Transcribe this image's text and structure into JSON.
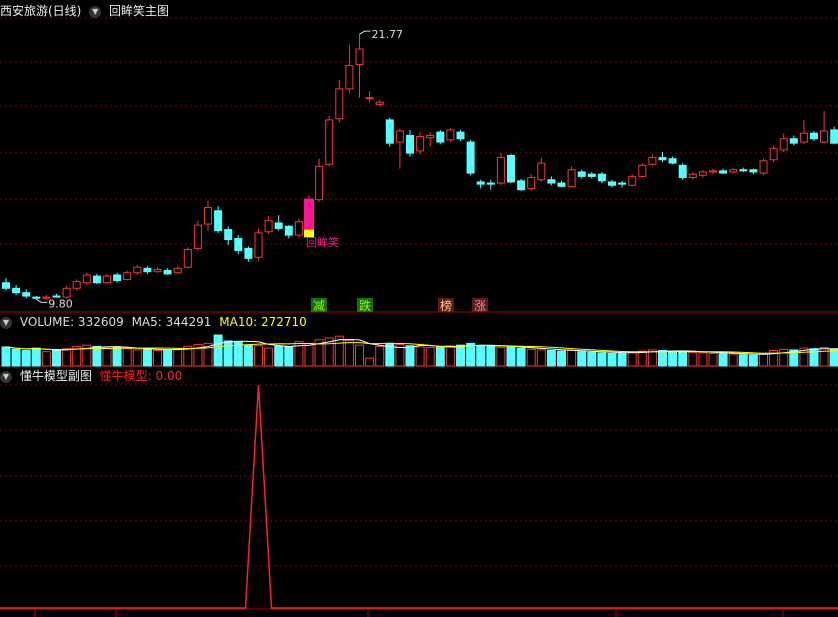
{
  "main_panel": {
    "stock_title": "西安旅游(日线)",
    "indicator_title": "回眸笑主图",
    "high_label": "21.77",
    "low_label": "9.80",
    "signal_label": "回眸笑",
    "markers": [
      "减",
      "跌",
      "榜",
      "涨"
    ]
  },
  "volume_panel": {
    "title": "VOLUME: 332609",
    "ma5_label": "MA5: 344291",
    "ma10_label": "MA10: 272710"
  },
  "sub_panel": {
    "title": "懂牛模型副图",
    "series_label": "懂牛模型: 0.00"
  },
  "colors": {
    "up": "#ff3232",
    "down": "#54ffff",
    "grid": "#8b0000",
    "ma5": "#ffffff",
    "ma10": "#ffff00",
    "signal": "#ff1493",
    "model_line": "#ff2020"
  },
  "chart_data": {
    "type": "candlestick",
    "price_range": [
      9.5,
      22.5
    ],
    "high": 21.77,
    "low": 9.8,
    "candles": [
      [
        10.55,
        10.3,
        10.75,
        10.2
      ],
      [
        10.3,
        10.1,
        10.45,
        10.0
      ],
      [
        10.1,
        9.95,
        10.25,
        9.85
      ],
      [
        9.9,
        9.85,
        9.95,
        9.8
      ],
      [
        9.85,
        9.9,
        10.0,
        9.8
      ],
      [
        9.95,
        9.92,
        10.05,
        9.88
      ],
      [
        9.9,
        10.3,
        10.4,
        9.85
      ],
      [
        10.3,
        10.6,
        10.7,
        10.2
      ],
      [
        10.55,
        10.9,
        11.0,
        10.45
      ],
      [
        10.85,
        10.55,
        10.95,
        10.5
      ],
      [
        10.55,
        10.85,
        10.95,
        10.5
      ],
      [
        10.9,
        10.65,
        11.0,
        10.55
      ],
      [
        10.7,
        11.0,
        11.1,
        10.65
      ],
      [
        11.0,
        11.25,
        11.35,
        10.9
      ],
      [
        11.2,
        11.05,
        11.3,
        10.95
      ],
      [
        11.05,
        11.15,
        11.25,
        11.0
      ],
      [
        11.1,
        10.95,
        11.2,
        10.9
      ],
      [
        11.0,
        11.2,
        11.3,
        10.95
      ],
      [
        11.25,
        12.05,
        12.15,
        11.2
      ],
      [
        12.1,
        13.15,
        13.35,
        12.0
      ],
      [
        13.2,
        13.95,
        14.25,
        12.9
      ],
      [
        13.8,
        12.9,
        14.0,
        12.8
      ],
      [
        12.95,
        12.5,
        13.1,
        12.25
      ],
      [
        12.55,
        12.0,
        12.7,
        11.85
      ],
      [
        12.1,
        11.65,
        12.2,
        11.5
      ],
      [
        11.7,
        12.8,
        13.0,
        11.55
      ],
      [
        12.85,
        13.35,
        13.55,
        12.75
      ],
      [
        13.25,
        13.0,
        13.6,
        12.9
      ],
      [
        13.1,
        12.7,
        13.15,
        12.55
      ],
      [
        12.7,
        13.3,
        13.45,
        12.6
      ],
      [
        13.4,
        14.3,
        14.5,
        13.3
      ],
      [
        14.3,
        15.8,
        16.15,
        14.2
      ],
      [
        15.9,
        17.9,
        18.1,
        15.8
      ],
      [
        17.95,
        19.3,
        19.7,
        17.8
      ],
      [
        19.3,
        20.35,
        21.3,
        19.1
      ],
      [
        20.4,
        21.1,
        21.77,
        18.9
      ],
      [
        18.9,
        18.9,
        19.2,
        18.7
      ],
      [
        18.6,
        18.7,
        18.8,
        18.5
      ],
      [
        17.9,
        16.85,
        18.0,
        16.7
      ],
      [
        16.9,
        17.4,
        17.5,
        15.7
      ],
      [
        17.2,
        16.4,
        17.45,
        16.25
      ],
      [
        16.5,
        17.15,
        17.35,
        16.35
      ],
      [
        17.1,
        17.2,
        17.35,
        16.7
      ],
      [
        17.35,
        16.9,
        17.45,
        16.8
      ],
      [
        17.0,
        17.45,
        17.55,
        16.9
      ],
      [
        17.35,
        17.05,
        17.45,
        16.95
      ],
      [
        16.9,
        15.5,
        17.0,
        15.4
      ],
      [
        15.1,
        15.0,
        15.2,
        14.8
      ],
      [
        15.05,
        15.0,
        15.2,
        14.75
      ],
      [
        15.05,
        16.2,
        16.4,
        14.95
      ],
      [
        16.3,
        15.1,
        16.35,
        15.05
      ],
      [
        15.15,
        14.75,
        15.25,
        14.7
      ],
      [
        14.8,
        15.3,
        15.45,
        14.7
      ],
      [
        15.2,
        15.95,
        16.2,
        15.1
      ],
      [
        15.2,
        15.05,
        15.35,
        14.95
      ],
      [
        15.05,
        14.9,
        15.15,
        14.85
      ],
      [
        14.9,
        15.65,
        15.8,
        14.85
      ],
      [
        15.55,
        15.35,
        15.65,
        15.25
      ],
      [
        15.45,
        15.35,
        15.55,
        15.25
      ],
      [
        15.45,
        15.15,
        15.55,
        15.05
      ],
      [
        15.1,
        14.95,
        15.2,
        14.85
      ],
      [
        15.05,
        15.0,
        15.15,
        14.85
      ],
      [
        14.95,
        15.35,
        15.45,
        14.9
      ],
      [
        15.35,
        15.85,
        15.95,
        15.3
      ],
      [
        15.9,
        16.2,
        16.35,
        15.8
      ],
      [
        16.2,
        16.1,
        16.45,
        16.0
      ],
      [
        16.15,
        15.95,
        16.25,
        15.9
      ],
      [
        15.85,
        15.3,
        15.95,
        15.2
      ],
      [
        15.3,
        15.45,
        15.55,
        15.2
      ],
      [
        15.4,
        15.55,
        15.65,
        15.3
      ],
      [
        15.55,
        15.6,
        15.7,
        15.45
      ],
      [
        15.6,
        15.5,
        15.7,
        15.45
      ],
      [
        15.55,
        15.65,
        15.75,
        15.5
      ],
      [
        15.65,
        15.6,
        15.75,
        15.55
      ],
      [
        15.65,
        15.55,
        15.7,
        15.45
      ],
      [
        15.5,
        16.05,
        16.15,
        15.4
      ],
      [
        16.1,
        16.6,
        16.75,
        16.0
      ],
      [
        16.55,
        17.05,
        17.3,
        16.45
      ],
      [
        17.05,
        16.85,
        17.2,
        16.75
      ],
      [
        16.9,
        17.3,
        17.9,
        16.8
      ],
      [
        17.3,
        17.05,
        17.4,
        16.95
      ],
      [
        16.9,
        17.4,
        18.3,
        16.85
      ],
      [
        17.45,
        16.85,
        17.6,
        16.8
      ],
      [
        16.95,
        17.55,
        18.6,
        16.85
      ],
      [
        17.5,
        17.4,
        18.25,
        17.3
      ]
    ],
    "volume": {
      "title": "VOLUME",
      "last": 332609,
      "ma5": 344291,
      "ma10": 272710,
      "values": [
        320000,
        280000,
        260000,
        300000,
        240000,
        260000,
        290000,
        330000,
        350000,
        330000,
        300000,
        310000,
        290000,
        270000,
        280000,
        260000,
        270000,
        290000,
        330000,
        360000,
        380000,
        520000,
        420000,
        400000,
        350000,
        340000,
        300000,
        330000,
        320000,
        410000,
        380000,
        440000,
        470000,
        500000,
        430000,
        350000,
        130000,
        330000,
        380000,
        360000,
        340000,
        320000,
        310000,
        330000,
        340000,
        350000,
        380000,
        340000,
        330000,
        310000,
        320000,
        300000,
        280000,
        270000,
        260000,
        250000,
        260000,
        240000,
        230000,
        220000,
        210000,
        220000,
        230000,
        250000,
        270000,
        260000,
        250000,
        240000,
        230000,
        220000,
        210000,
        220000,
        200000,
        190000,
        180000,
        200000,
        260000,
        280000,
        270000,
        300000,
        290000,
        310000,
        280000,
        300000,
        332609
      ]
    },
    "model": {
      "series_name": "懂牛模型",
      "last": 0.0,
      "peak_index": 25,
      "peak_value": 1
    }
  }
}
